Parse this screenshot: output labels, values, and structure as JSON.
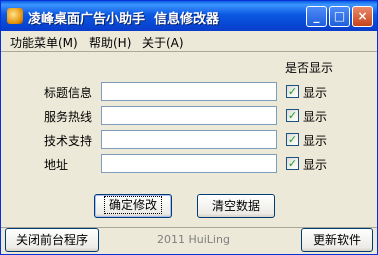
{
  "window": {
    "title": "凌峰桌面广告小助手  信息修改器",
    "minimize_symbol": "_",
    "maximize_symbol": "□",
    "close_symbol": "×",
    "icons": [
      "app-icon",
      "minimize-icon",
      "maximize-icon",
      "close-icon"
    ]
  },
  "menu": {
    "items": [
      "功能菜单(M)",
      "帮助(H)",
      "关于(A)"
    ]
  },
  "form": {
    "show_header": "是否显示",
    "rows": [
      {
        "label": "标题信息",
        "value": "",
        "show_checked": true,
        "show_label": "显示"
      },
      {
        "label": "服务热线",
        "value": "",
        "show_checked": true,
        "show_label": "显示"
      },
      {
        "label": "技术支持",
        "value": "",
        "show_checked": true,
        "show_label": "显示"
      },
      {
        "label": "地址",
        "value": "",
        "show_checked": true,
        "show_label": "显示"
      }
    ],
    "check_mark": "✓"
  },
  "buttons": {
    "confirm": "确定修改",
    "clear": "清空数据",
    "close_front": "关闭前台程序",
    "update": "更新软件"
  },
  "footer": {
    "copyright": "2011 HuiLing"
  },
  "colors": {
    "titlebar": "#0b59e3",
    "window_bg": "#ece9d8",
    "button_border": "#003c74",
    "check_green": "#21a121"
  }
}
